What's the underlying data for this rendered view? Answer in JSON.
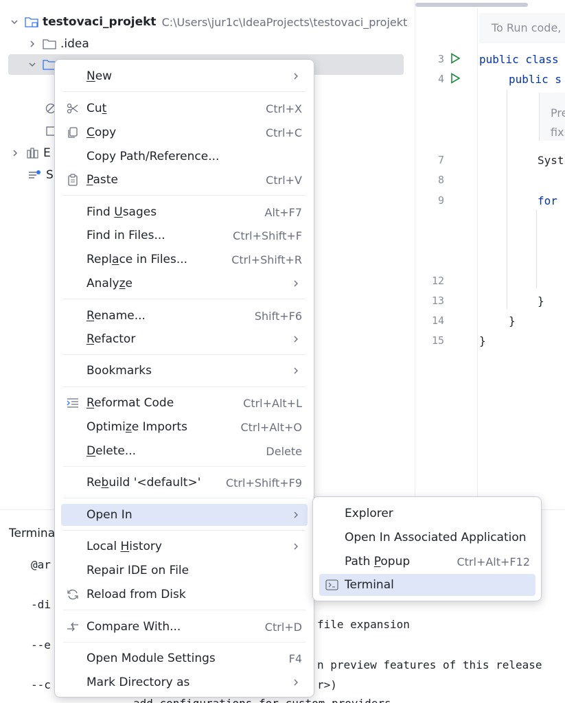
{
  "tree": {
    "project_name": "testovaci_projekt",
    "project_path": "C:\\Users\\jur1c\\IdeaProjects\\testovaci_projekt",
    "idea_folder": ".idea",
    "partial_ext": "E",
    "partial_scratch": "S"
  },
  "editor": {
    "hint_top": "To Run code,",
    "hint_mid_1": "Pre",
    "hint_mid_2": "fixi",
    "lines": [
      "3",
      "4",
      "7",
      "8",
      "9",
      "12",
      "13",
      "14",
      "15"
    ],
    "code_public_class": "public class",
    "code_public_s": "public s",
    "code_syst": "Syst",
    "code_for": "for",
    "brace": "}"
  },
  "panel": {
    "title": "Termina",
    "lines": [
      "@ar",
      "-di",
      "file expansion",
      "--e",
      "n preview features of this release",
      "--c",
      "r>)",
      "add configurations for custom providers"
    ]
  },
  "menu": {
    "new": "New",
    "cut": "Cut",
    "cut_sc": "Ctrl+X",
    "copy": "Copy",
    "copy_sc": "Ctrl+C",
    "copy_path": "Copy Path/Reference...",
    "paste": "Paste",
    "paste_sc": "Ctrl+V",
    "find_usages": "Find Usages",
    "find_usages_sc": "Alt+F7",
    "find_in_files": "Find in Files...",
    "find_in_files_sc": "Ctrl+Shift+F",
    "replace_in_files": "Replace in Files...",
    "replace_in_files_sc": "Ctrl+Shift+R",
    "analyze": "Analyze",
    "rename": "Rename...",
    "rename_sc": "Shift+F6",
    "refactor": "Refactor",
    "bookmarks": "Bookmarks",
    "reformat": "Reformat Code",
    "reformat_sc": "Ctrl+Alt+L",
    "optimize": "Optimize Imports",
    "optimize_sc": "Ctrl+Alt+O",
    "delete": "Delete...",
    "delete_sc": "Delete",
    "rebuild": "Rebuild '<default>'",
    "rebuild_sc": "Ctrl+Shift+F9",
    "open_in": "Open In",
    "local_history": "Local History",
    "repair": "Repair IDE on File",
    "reload": "Reload from Disk",
    "compare": "Compare With...",
    "compare_sc": "Ctrl+D",
    "module_settings": "Open Module Settings",
    "module_settings_sc": "F4",
    "mark_dir": "Mark Directory as"
  },
  "submenu": {
    "explorer": "Explorer",
    "associated": "Open In Associated Application",
    "path_popup": "Path Popup",
    "path_popup_sc": "Ctrl+Alt+F12",
    "terminal": "Terminal"
  },
  "colors": {
    "selection": "#dfe6f7",
    "keyword": "#0033b3",
    "run_icon": "#208a3c"
  }
}
